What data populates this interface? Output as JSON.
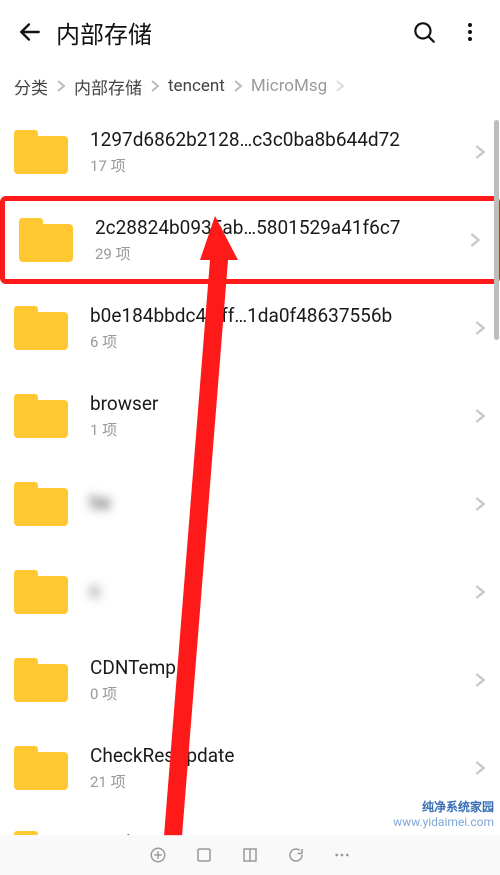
{
  "appbar": {
    "title": "内部存储"
  },
  "breadcrumb": {
    "items": [
      {
        "label": "分类"
      },
      {
        "label": "内部存储"
      },
      {
        "label": "tencent"
      },
      {
        "label": "MicroMsg"
      }
    ]
  },
  "list": [
    {
      "name": "1297d6862b2128…c3c0ba8b644d72",
      "sub": "17 项",
      "highlight": false
    },
    {
      "name": "2c28824b0935ab…5801529a41f6c7",
      "sub": "29 项",
      "highlight": true
    },
    {
      "name": "b0e184bbdc4a  ff…1da0f48637556b",
      "sub": "6 项"
    },
    {
      "name": "browser",
      "sub": "1 项"
    },
    {
      "name": "     he",
      "sub": "  ",
      "blur": true
    },
    {
      "name": "c   ",
      "sub": "   ",
      "blur": true
    },
    {
      "name": "CDNTemp",
      "sub": "0 项"
    },
    {
      "name": "CheckResUpdate",
      "sub": "21 项"
    },
    {
      "name": "crash",
      "sub": "",
      "cut": true
    }
  ],
  "watermark": {
    "line1": "纯净系统家园",
    "line2": "www.yidaimei.com"
  }
}
